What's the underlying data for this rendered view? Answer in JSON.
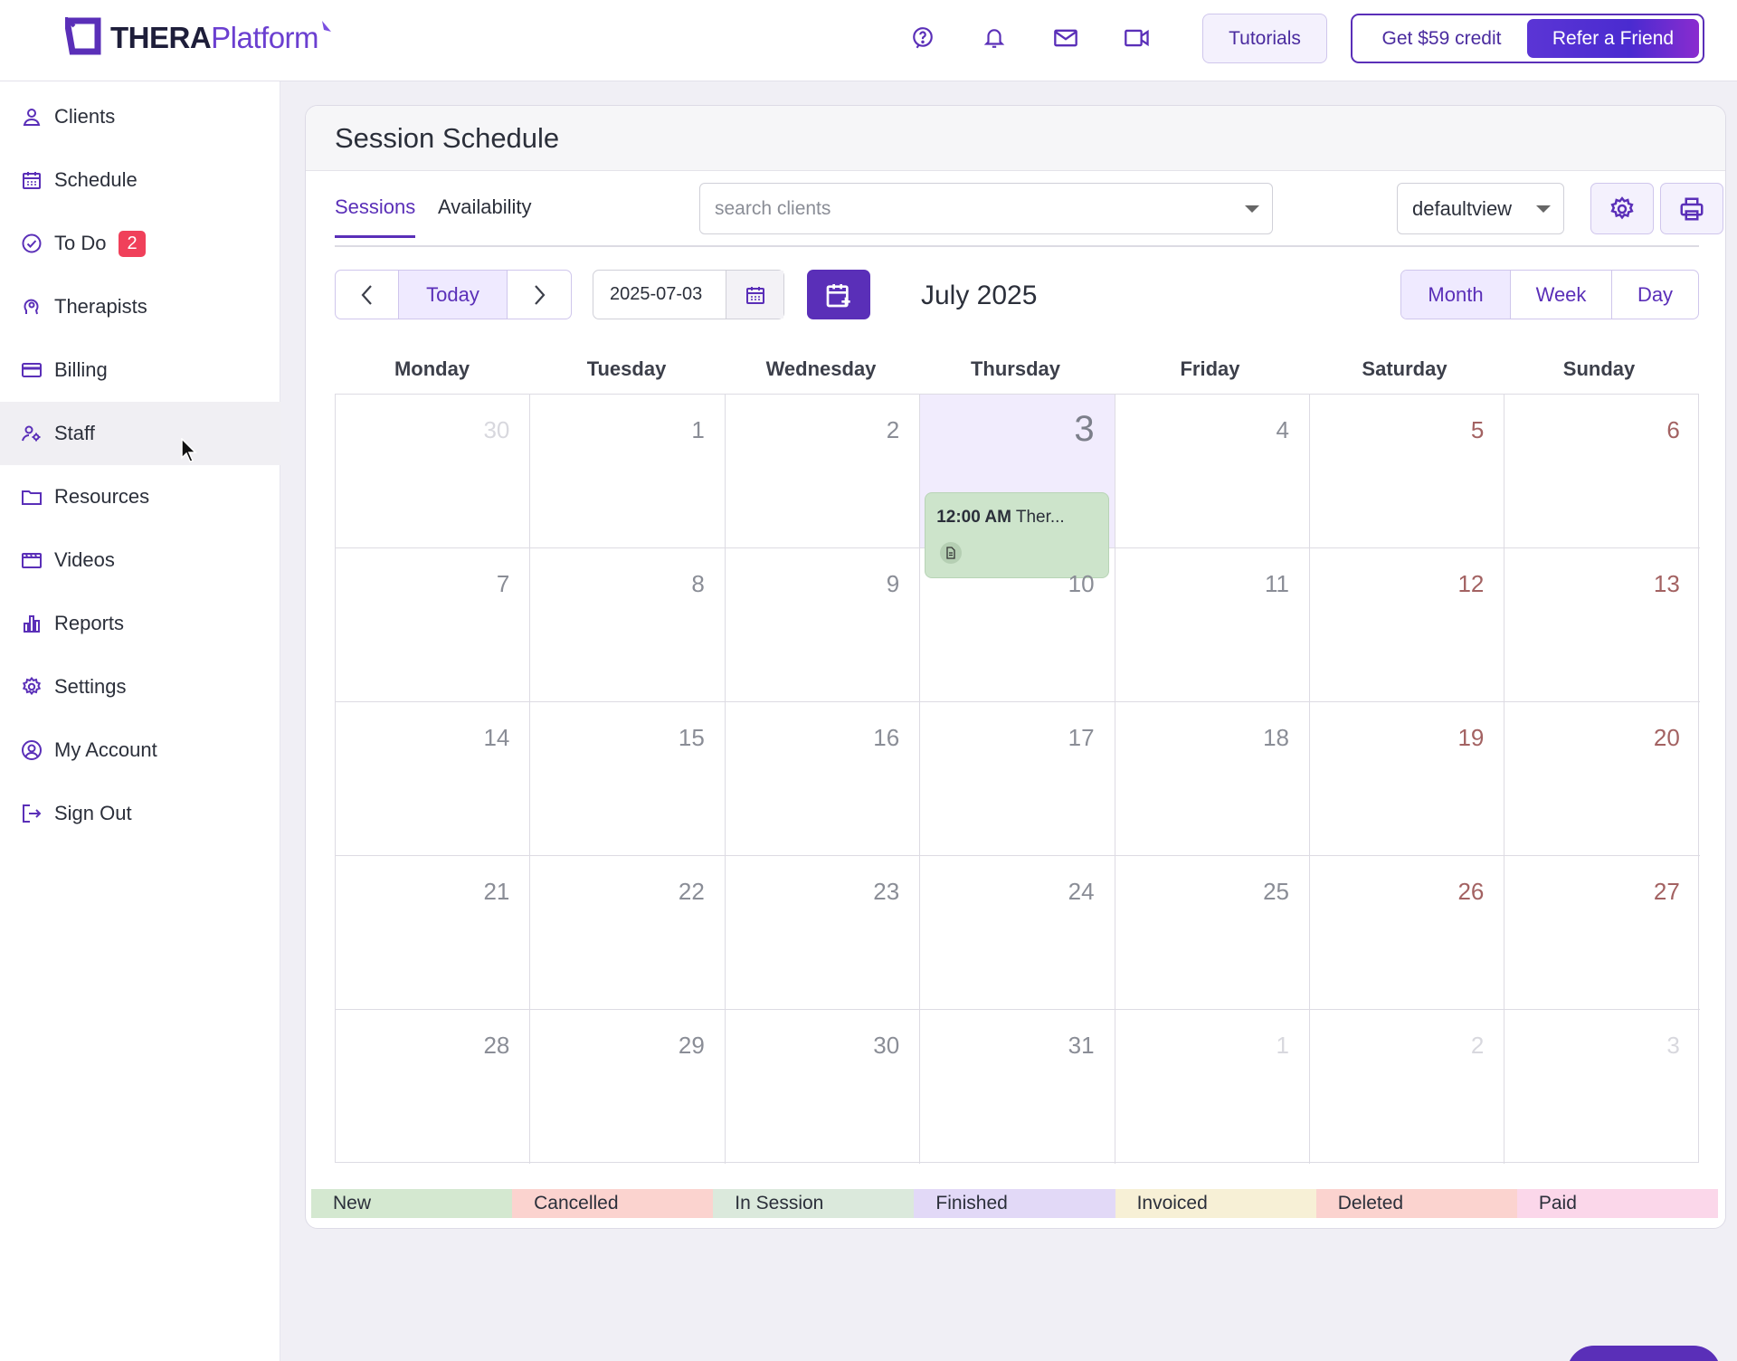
{
  "app": {
    "logo_left": "THERA",
    "logo_right": "Platform"
  },
  "topbar": {
    "tutorials_label": "Tutorials",
    "credit_label": "Get $59 credit",
    "refer_label": "Refer a Friend",
    "icons": [
      "help-icon",
      "bell-icon",
      "mail-icon",
      "video-icon"
    ]
  },
  "sidebar": {
    "items": [
      {
        "label": "Clients",
        "icon": "user-icon"
      },
      {
        "label": "Schedule",
        "icon": "calendar-icon"
      },
      {
        "label": "To Do",
        "icon": "check-circle-icon",
        "badge": "2"
      },
      {
        "label": "Therapists",
        "icon": "therapist-icon"
      },
      {
        "label": "Billing",
        "icon": "card-icon"
      },
      {
        "label": "Staff",
        "icon": "staff-icon"
      },
      {
        "label": "Resources",
        "icon": "folder-icon"
      },
      {
        "label": "Videos",
        "icon": "film-icon"
      },
      {
        "label": "Reports",
        "icon": "chart-icon"
      },
      {
        "label": "Settings",
        "icon": "gear-icon"
      },
      {
        "label": "My Account",
        "icon": "account-icon"
      },
      {
        "label": "Sign Out",
        "icon": "sign-out-icon"
      }
    ]
  },
  "schedule": {
    "title": "Session Schedule",
    "tabs": [
      "Sessions",
      "Availability"
    ],
    "search_placeholder": "search clients",
    "view_select": "defaultview",
    "today_label": "Today",
    "date_value": "2025-07-03",
    "month_title": "July 2025",
    "view_buttons": [
      "Month",
      "Week",
      "Day"
    ],
    "selected_view": "Month",
    "weekdays": [
      "Monday",
      "Tuesday",
      "Wednesday",
      "Thursday",
      "Friday",
      "Saturday",
      "Sunday"
    ],
    "weeks": [
      [
        "30",
        "1",
        "2",
        "3",
        "4",
        "5",
        "6"
      ],
      [
        "7",
        "8",
        "9",
        "10",
        "11",
        "12",
        "13"
      ],
      [
        "14",
        "15",
        "16",
        "17",
        "18",
        "19",
        "20"
      ],
      [
        "21",
        "22",
        "23",
        "24",
        "25",
        "26",
        "27"
      ],
      [
        "28",
        "29",
        "30",
        "31",
        "1",
        "2",
        "3"
      ]
    ],
    "event": {
      "time": "12:00 AM",
      "title": "Ther..."
    },
    "legend": [
      {
        "label": "New",
        "color": "#d4e8d0"
      },
      {
        "label": "Cancelled",
        "color": "#fbd3cf"
      },
      {
        "label": "In Session",
        "color": "#dbe9dc"
      },
      {
        "label": "Finished",
        "color": "#e2d9f7"
      },
      {
        "label": "Invoiced",
        "color": "#f7f0d6"
      },
      {
        "label": "Deleted",
        "color": "#fbd3cf"
      },
      {
        "label": "Paid",
        "color": "#fbd7ea"
      }
    ]
  }
}
